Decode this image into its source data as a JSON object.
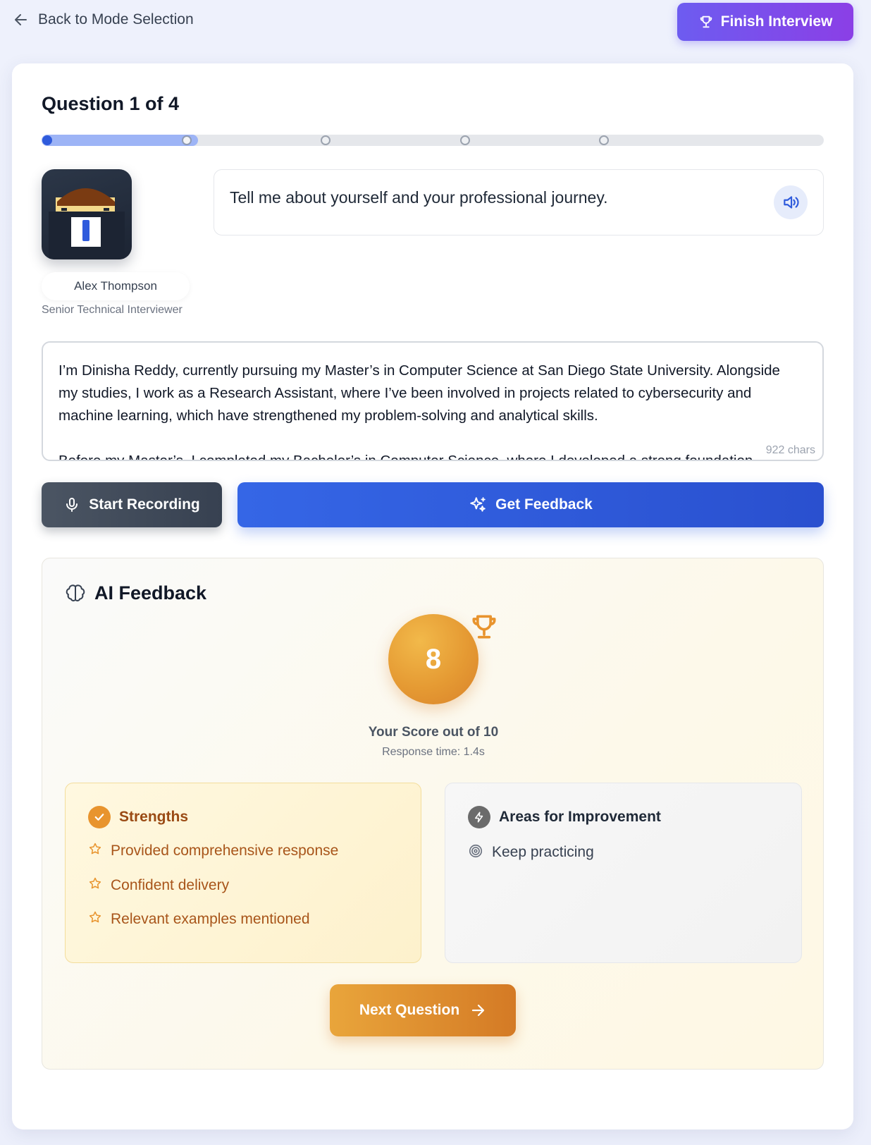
{
  "nav": {
    "back_label": "Back to Mode Selection",
    "finish_label": "Finish Interview"
  },
  "question": {
    "counter_label": "Question 1 of 4",
    "progress": {
      "current": 1,
      "total": 4,
      "fill_fraction": 0.2,
      "steps": 5
    },
    "text": "Tell me about yourself and your professional journey."
  },
  "interviewer": {
    "name": "Alex Thompson",
    "role": "Senior Technical Interviewer"
  },
  "answer": {
    "text": "I’m Dinisha Reddy, currently pursuing my Master’s in Computer Science at San Diego State University. Alongside my studies, I work as a Research Assistant, where I’ve been involved in projects related to cybersecurity and machine learning, which have strengthened my problem-solving and analytical skills.\n\nBefore my Master’s, I completed my Bachelor’s in Computer Science, where I developed a strong foundation",
    "char_count": "922 chars"
  },
  "actions": {
    "record_label": "Start Recording",
    "feedback_label": "Get Feedback"
  },
  "feedback": {
    "title": "AI Feedback",
    "score": "8",
    "score_label": "Your Score out of 10",
    "response_time": "Response time: 1.4s",
    "strengths_title": "Strengths",
    "strengths": [
      "Provided comprehensive response",
      "Confident delivery",
      "Relevant examples mentioned"
    ],
    "improvements_title": "Areas for Improvement",
    "improvements": [
      "Keep practicing"
    ],
    "next_label": "Next Question"
  },
  "colors": {
    "accent_blue": "#3566e6",
    "accent_purple": "#7c4dea",
    "accent_orange": "#e59a33",
    "strengths_text": "#a8551a"
  },
  "icons": {
    "back": "arrow-left-icon",
    "finish": "trophy-icon",
    "speaker": "speaker-icon",
    "record": "microphone-icon",
    "feedback": "sparkles-icon",
    "ai": "brain-icon",
    "strengths": "check-circle-icon",
    "strength_item": "star-icon",
    "improvements": "lightning-icon",
    "improve_item": "target-icon",
    "next": "arrow-right-icon"
  }
}
